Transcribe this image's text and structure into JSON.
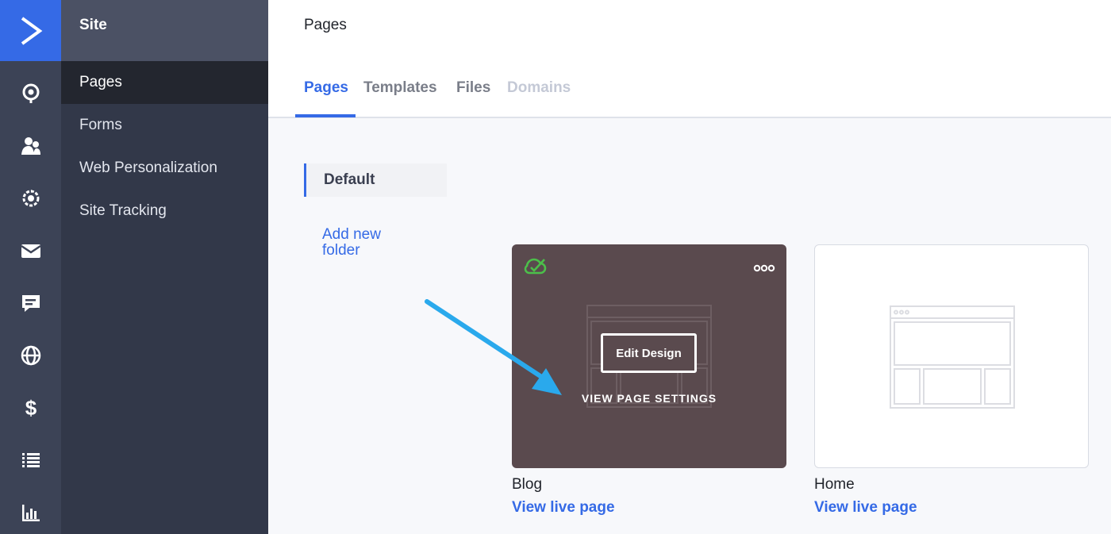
{
  "sidebar": {
    "title": "Site",
    "items": [
      {
        "label": "Pages",
        "active": true
      },
      {
        "label": "Forms",
        "active": false
      },
      {
        "label": "Web Personalization",
        "active": false
      },
      {
        "label": "Site Tracking",
        "active": false
      }
    ]
  },
  "rail": {
    "logo_icon": "activecampaign-logo-icon",
    "icons": [
      "location-pin-icon",
      "contacts-icon",
      "automation-gear-icon",
      "email-icon",
      "chat-icon",
      "globe-icon",
      "dollar-icon",
      "list-icon",
      "reports-chart-icon"
    ]
  },
  "header": {
    "title": "Pages",
    "tabs": [
      {
        "label": "Pages",
        "state": "active"
      },
      {
        "label": "Templates",
        "state": "normal"
      },
      {
        "label": "Files",
        "state": "normal"
      },
      {
        "label": "Domains",
        "state": "disabled"
      }
    ]
  },
  "folders": {
    "current": "Default",
    "add_label": "Add new folder"
  },
  "cards": [
    {
      "name": "Blog",
      "link": "View live page",
      "edit_label": "Edit Design",
      "settings_label": "VIEW PAGE SETTINGS",
      "status_icon": "cloud-check-icon",
      "menu_icon": "more-options-icon"
    },
    {
      "name": "Home",
      "link": "View live page"
    }
  ],
  "colors": {
    "accent": "#356ae6",
    "rail": "#3c4356",
    "sidebar": "#323849",
    "card_hover": "#5a4a4e",
    "published": "#4cbf4a",
    "annotation_arrow": "#2aa9ec"
  }
}
